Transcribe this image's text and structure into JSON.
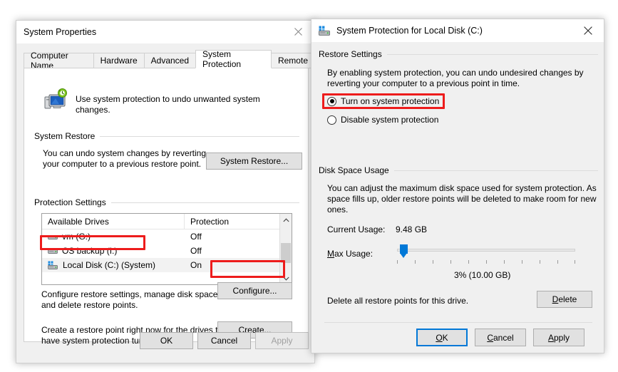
{
  "system_properties": {
    "title": "System Properties",
    "close_icon": "close-icon",
    "tabs": [
      {
        "label": "Computer Name",
        "active": false
      },
      {
        "label": "Hardware",
        "active": false
      },
      {
        "label": "Advanced",
        "active": false
      },
      {
        "label": "System Protection",
        "active": true
      },
      {
        "label": "Remote",
        "active": false
      }
    ],
    "intro": {
      "icon": "system-protection-icon",
      "text": "Use system protection to undo unwanted system changes."
    },
    "system_restore": {
      "group_label": "System Restore",
      "description_line1": "You can undo system changes by reverting",
      "description_line2": "your computer to a previous restore point.",
      "button_label": "System Restore..."
    },
    "protection_settings": {
      "group_label": "Protection Settings",
      "columns": [
        "Available Drives",
        "Protection"
      ],
      "rows": [
        {
          "drive": "vm (G:)",
          "protection": "Off",
          "icon": "drive-icon",
          "selected": false,
          "highlighted": false
        },
        {
          "drive": "OS backup (I:)",
          "protection": "Off",
          "icon": "drive-icon",
          "selected": false,
          "highlighted": false
        },
        {
          "drive": "Local Disk (C:) (System)",
          "protection": "On",
          "icon": "system-drive-icon",
          "selected": true,
          "highlighted": true
        }
      ],
      "configure": {
        "description_line1": "Configure restore settings, manage disk space,",
        "description_line2": "and delete restore points.",
        "button_label": "Configure...",
        "highlighted": true
      },
      "create": {
        "description_line1": "Create a restore point right now for the drives that",
        "description_line2": "have system protection turned on.",
        "button_label": "Create..."
      }
    },
    "footer_buttons": [
      {
        "label": "OK",
        "disabled": false,
        "focused": false
      },
      {
        "label": "Cancel",
        "disabled": false,
        "focused": false
      },
      {
        "label": "Apply",
        "disabled": true,
        "focused": false
      }
    ]
  },
  "system_protection_dialog": {
    "title": "System Protection for Local Disk (C:)",
    "title_icon": "system-drive-icon",
    "close_icon": "close-icon",
    "restore_settings": {
      "group_label": "Restore Settings",
      "description_line1": "By enabling system protection, you can undo undesired changes by",
      "description_line2": "reverting your computer to a previous point in time.",
      "options": [
        {
          "label": "Turn on system protection",
          "selected": true,
          "highlighted": true
        },
        {
          "label": "Disable system protection",
          "selected": false,
          "highlighted": false
        }
      ]
    },
    "disk_space_usage": {
      "group_label": "Disk Space Usage",
      "description_line1": "You can adjust the maximum disk space used for system protection. As",
      "description_line2": "space fills up, older restore points will be deleted to make room for new",
      "description_line3": "ones.",
      "current_usage_label": "Current Usage:",
      "current_usage_value": "9.48 GB",
      "max_usage_label_prefix": "M",
      "max_usage_label_rest": "ax Usage:",
      "slider_percent": 3,
      "slider_value_text": "3% (10.00 GB)"
    },
    "delete_section": {
      "description": "Delete all restore points for this drive.",
      "button_prefix": "D",
      "button_rest": "elete"
    },
    "footer_buttons": [
      {
        "prefix": "O",
        "rest": "K",
        "focused": true
      },
      {
        "prefix": "C",
        "rest": "ancel",
        "focused": false
      },
      {
        "prefix": "A",
        "rest": "pply",
        "focused": false
      }
    ]
  },
  "colors": {
    "annotation_red": "#ed1c1c",
    "accent_blue": "#0078d7",
    "dialog_face": "#f0f0f0"
  }
}
